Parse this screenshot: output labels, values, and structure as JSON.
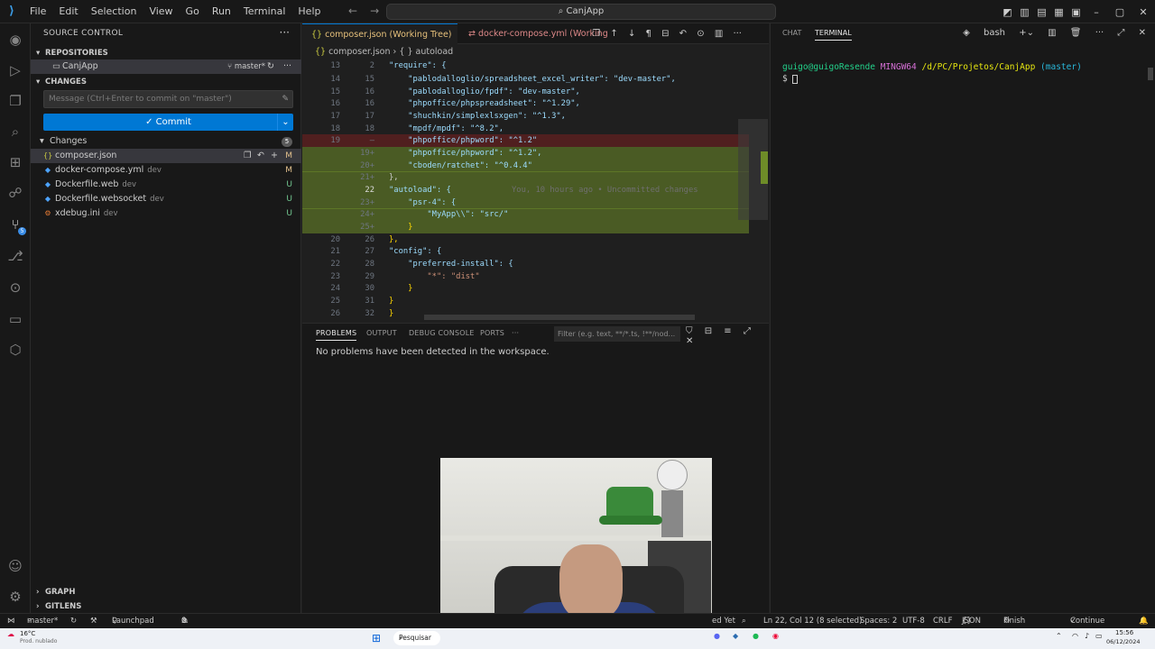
{
  "titlebar": {
    "menu": [
      "File",
      "Edit",
      "Selection",
      "View",
      "Go",
      "Run",
      "Terminal",
      "Help"
    ],
    "search": "CanjApp"
  },
  "sidebar": {
    "header": "SOURCE CONTROL",
    "repositories_label": "REPOSITORIES",
    "repo_name": "CanjApp",
    "repo_branch": "master*",
    "changes_section": "CHANGES",
    "commit_placeholder": "Message (Ctrl+Enter to commit on \"master\")",
    "commit_label": "Commit",
    "changes_group": "Changes",
    "changes_count": "5",
    "files": [
      {
        "name": "composer.json",
        "dir": "",
        "status": "M"
      },
      {
        "name": "docker-compose.yml",
        "dir": "dev",
        "status": "M"
      },
      {
        "name": "Dockerfile.web",
        "dir": "dev",
        "status": "U"
      },
      {
        "name": "Dockerfile.websocket",
        "dir": "dev",
        "status": "U"
      },
      {
        "name": "xdebug.ini",
        "dir": "dev",
        "status": "U"
      }
    ],
    "graph_label": "GRAPH",
    "gitlens_label": "GITLENS"
  },
  "editor": {
    "tab1": "composer.json (Working Tree) M",
    "tab2": "docker-compose.yml (Working Tr",
    "breadcrumb_file": "composer.json",
    "breadcrumb_symbol": "{ } autoload",
    "ghost_text": "You, 10 hours ago • Uncommitted changes",
    "lines": [
      {
        "n1": "13",
        "n2": "2",
        "text": "\"require\": {",
        "kind": ""
      },
      {
        "n1": "14",
        "n2": "15",
        "text": "    \"pablodalloglio/spreadsheet_excel_writer\": \"dev-master\",",
        "kind": ""
      },
      {
        "n1": "15",
        "n2": "16",
        "text": "    \"pablodalloglio/fpdf\": \"dev-master\",",
        "kind": ""
      },
      {
        "n1": "16",
        "n2": "16",
        "text": "    \"phpoffice/phpspreadsheet\": \"^1.29\",",
        "kind": ""
      },
      {
        "n1": "17",
        "n2": "17",
        "text": "    \"shuchkin/simplexlsxgen\": \"^1.3\",",
        "kind": ""
      },
      {
        "n1": "18",
        "n2": "18",
        "text": "    \"mpdf/mpdf\": \"^8.2\",",
        "kind": ""
      },
      {
        "n1": "19",
        "n2": "—",
        "text": "    \"phpoffice/phpword\": \"^1.2\"",
        "kind": "del"
      },
      {
        "n1": "",
        "n2": "19+",
        "text": "    \"phpoffice/phpword\": \"^1.2\",",
        "kind": "add"
      },
      {
        "n1": "",
        "n2": "20+",
        "text": "    \"cboden/ratchet\": \"^0.4.4\"",
        "kind": "add"
      },
      {
        "n1": "",
        "n2": "21+",
        "text": "},",
        "kind": "add"
      },
      {
        "n1": "",
        "n2": "22",
        "text": "\"autoload\": {",
        "kind": "add"
      },
      {
        "n1": "",
        "n2": "23+",
        "text": "    \"psr-4\": {",
        "kind": "add"
      },
      {
        "n1": "",
        "n2": "24+",
        "text": "        \"MyApp\\\\\": \"src/\"",
        "kind": "add"
      },
      {
        "n1": "",
        "n2": "25+",
        "text": "    }",
        "kind": "add"
      },
      {
        "n1": "20",
        "n2": "26",
        "text": "},",
        "kind": ""
      },
      {
        "n1": "21",
        "n2": "27",
        "text": "\"config\": {",
        "kind": ""
      },
      {
        "n1": "22",
        "n2": "28",
        "text": "    \"preferred-install\": {",
        "kind": ""
      },
      {
        "n1": "23",
        "n2": "29",
        "text": "        \"*\": \"dist\"",
        "kind": ""
      },
      {
        "n1": "24",
        "n2": "30",
        "text": "    }",
        "kind": ""
      },
      {
        "n1": "25",
        "n2": "31",
        "text": "}",
        "kind": ""
      },
      {
        "n1": "26",
        "n2": "32",
        "text": "}",
        "kind": ""
      }
    ]
  },
  "panel": {
    "tabs": [
      "PROBLEMS",
      "OUTPUT",
      "DEBUG CONSOLE",
      "PORTS"
    ],
    "filter_placeholder": "Filter (e.g. text, **/*.ts, !**/nod...",
    "message": "No problems have been detected in the workspace."
  },
  "terminal": {
    "tabs": [
      "CHAT",
      "TERMINAL"
    ],
    "shell": "bash",
    "user": "guigo@guigoResende",
    "env": "MINGW64",
    "path": "/d/PC/Projetos/CanjApp",
    "branch": "(master)",
    "prompt": "$"
  },
  "statusbar": {
    "branch": "master*",
    "launchpad": "Launchpad",
    "problems": "0",
    "warnings": "0",
    "ded_yet": "ed Yet",
    "position": "Ln 22, Col 12 (8 selected)",
    "spaces": "Spaces: 2",
    "encoding": "UTF-8",
    "eol": "CRLF",
    "language": "JSON",
    "finish_setup": "Finish Setup",
    "continue": "Continue (NE)"
  },
  "taskbar": {
    "weather": "16°C",
    "weather_sub": "Prod. nublado",
    "search": "Pesquisar",
    "time": "15:56",
    "date": "06/12/2024"
  },
  "colors": {
    "accent": "#0078d4",
    "modified": "#e2c08d",
    "untracked": "#73c991"
  }
}
